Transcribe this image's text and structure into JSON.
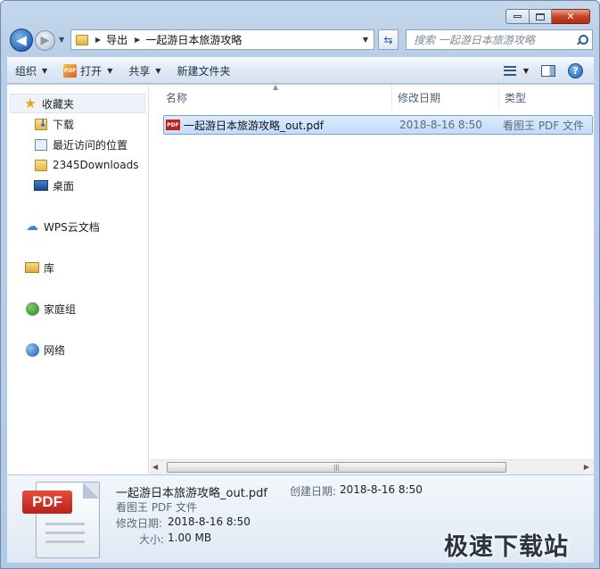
{
  "window": {
    "controls": {
      "min": "minimize",
      "max": "maximize",
      "close": "✕"
    }
  },
  "addressbar": {
    "crumbs": [
      "导出",
      "一起游日本旅游攻略"
    ],
    "search_placeholder": "搜索 一起游日本旅游攻略"
  },
  "toolbar": {
    "organize": "组织",
    "open": "打开",
    "share": "共享",
    "new_folder": "新建文件夹",
    "help": "?"
  },
  "navpane": {
    "favorites": "收藏夹",
    "fav_items": [
      "下载",
      "最近访问的位置",
      "2345Downloads",
      "桌面"
    ],
    "wps": "WPS云文档",
    "library": "库",
    "homegroup": "家庭组",
    "network": "网络"
  },
  "columns": {
    "name": "名称",
    "modified": "修改日期",
    "type": "类型"
  },
  "files": [
    {
      "name": "一起游日本旅游攻略_out.pdf",
      "modified": "2018-8-16 8:50",
      "type": "看图王 PDF 文件",
      "icon": "pdf-icon"
    }
  ],
  "details": {
    "badge": "PDF",
    "filename": "一起游日本旅游攻略_out.pdf",
    "created_label": "创建日期:",
    "created": "2018-8-16 8:50",
    "type": "看图王 PDF 文件",
    "modified_label": "修改日期:",
    "modified": "2018-8-16 8:50",
    "size_label": "大小:",
    "size": "1.00 MB"
  },
  "watermark": "极速下载站",
  "colors": {
    "selection": "#c1dcfc",
    "chrome": "#b9cfe8",
    "accent": "#2c69b8"
  }
}
